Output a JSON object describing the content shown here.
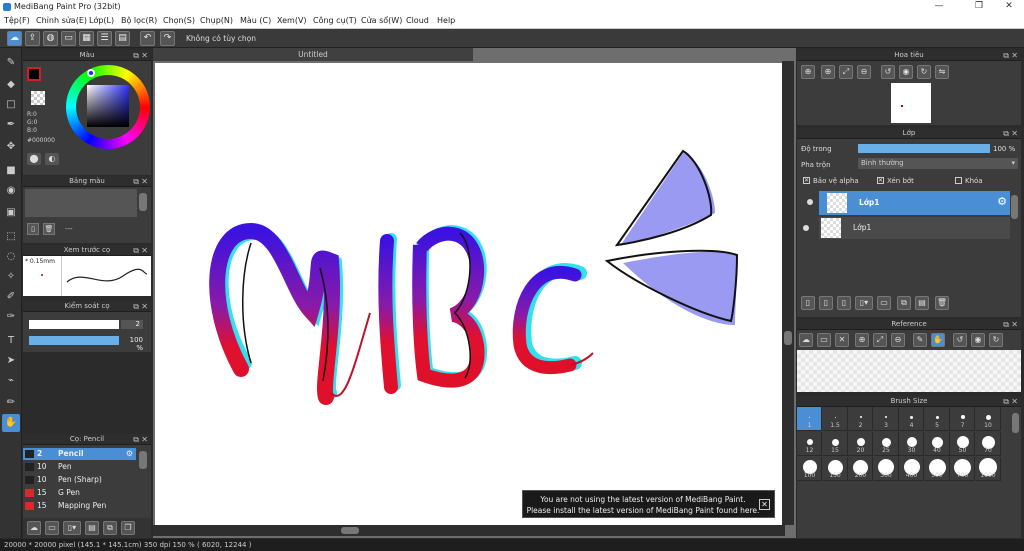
{
  "window": {
    "title": "MediBang Paint Pro (32bit)"
  },
  "menu": [
    "Tệp(F)",
    "Chỉnh sửa(E)",
    "Lớp(L)",
    "Bộ lọc(R)",
    "Chọn(S)",
    "Chụp(N)",
    "Màu (C)",
    "Xem(V)",
    "Công cụ(T)",
    "Cửa sổ(W)",
    "Cloud",
    "Help"
  ],
  "toolbar": {
    "option_label": "Không có tùy chọn"
  },
  "color_panel": {
    "title": "Màu",
    "rgb": [
      "R:0",
      "G:0",
      "B:0"
    ],
    "hex": "#000000",
    "fg": "#000000",
    "accent": "#cc2222"
  },
  "palette_panel": {
    "title": "Bảng màu",
    "dash": "---"
  },
  "brush_preview": {
    "title": "Xem trước cọ",
    "size": "0.15mm"
  },
  "brush_control": {
    "title": "Kiểm soát cọ",
    "width_value": "2",
    "opacity_value": "100 %",
    "opacity_fraction": 1.0
  },
  "brush_list": {
    "title": "Cọ: Pencil",
    "items": [
      {
        "size": "2",
        "name": "Pencil",
        "color": "#222222"
      },
      {
        "size": "10",
        "name": "Pen",
        "color": "#222222"
      },
      {
        "size": "10",
        "name": "Pen (Sharp)",
        "color": "#222222"
      },
      {
        "size": "15",
        "name": "G Pen",
        "color": "#d62b2b"
      },
      {
        "size": "15",
        "name": "Mapping Pen",
        "color": "#d62b2b"
      }
    ]
  },
  "canvas": {
    "tab": "Untitled"
  },
  "toast": {
    "line1": "You are not using the latest version of MediBang Paint.",
    "line2": "Please install the latest version of MediBang Paint found here.",
    "close": "✕"
  },
  "status": {
    "text": "20000 * 20000 pixel   (145.1 * 145.1cm)   350 dpi   150 %   ( 6020, 12244 )"
  },
  "navigator": {
    "title": "Hoa tiêu"
  },
  "layer_panel": {
    "title": "Lớp",
    "opacity_label": "Độ trong",
    "opacity_value": "100 %",
    "opacity_fraction": 1.0,
    "blend_label": "Pha trộn",
    "blend_value": "Bình thường",
    "protect_alpha": "Bảo vệ alpha",
    "clipping": "Xén bớt",
    "lock": "Khóa",
    "layers": [
      {
        "name": "Lớp1"
      },
      {
        "name": "Lớp1"
      }
    ]
  },
  "reference": {
    "title": "Reference"
  },
  "brush_size": {
    "title": "Brush Size",
    "sizes": [
      "1",
      "1.5",
      "2",
      "3",
      "4",
      "5",
      "7",
      "10",
      "12",
      "15",
      "20",
      "25",
      "30",
      "40",
      "50",
      "70",
      "100",
      "150",
      "200",
      "300",
      "400",
      "500",
      "700",
      "1000"
    ],
    "selected": "1"
  }
}
